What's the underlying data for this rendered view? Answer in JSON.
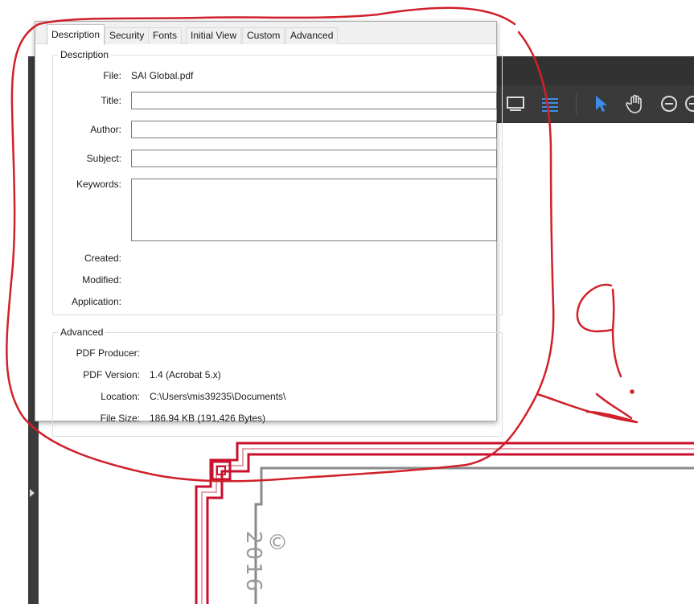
{
  "dialog": {
    "tabs": [
      {
        "label": "Description"
      },
      {
        "label": "Security"
      },
      {
        "label": "Fonts"
      },
      {
        "label": "Initial View"
      },
      {
        "label": "Custom"
      },
      {
        "label": "Advanced"
      }
    ],
    "description": {
      "legend": "Description",
      "file_label": "File:",
      "file_value": "SAI Global.pdf",
      "title_label": "Title:",
      "title_value": "",
      "author_label": "Author:",
      "author_value": "",
      "subject_label": "Subject:",
      "subject_value": "",
      "keywords_label": "Keywords:",
      "keywords_value": "",
      "created_label": "Created:",
      "modified_label": "Modified:",
      "application_label": "Application:"
    },
    "advanced": {
      "legend": "Advanced",
      "producer_label": "PDF Producer:",
      "version_label": "PDF Version:",
      "version_value": "1.4 (Acrobat 5.x)",
      "location_label": "Location:",
      "location_value": "C:\\Users\\mis39235\\Documents\\",
      "filesize_label": "File Size:",
      "filesize_value": "186.94 KB (191,426 Bytes)"
    }
  },
  "document": {
    "copyright_text": "© 2016"
  },
  "colors": {
    "annotation_red": "#d0202a",
    "toolbar_bg": "#3a3a3a",
    "accent_blue": "#3d8ee8",
    "border_red": "#c8102e"
  },
  "icons": [
    "monitor-icon",
    "scroll-mode-icon",
    "select-arrow-icon",
    "hand-tool-icon",
    "zoom-out-icon",
    "zoom-in-icon"
  ]
}
